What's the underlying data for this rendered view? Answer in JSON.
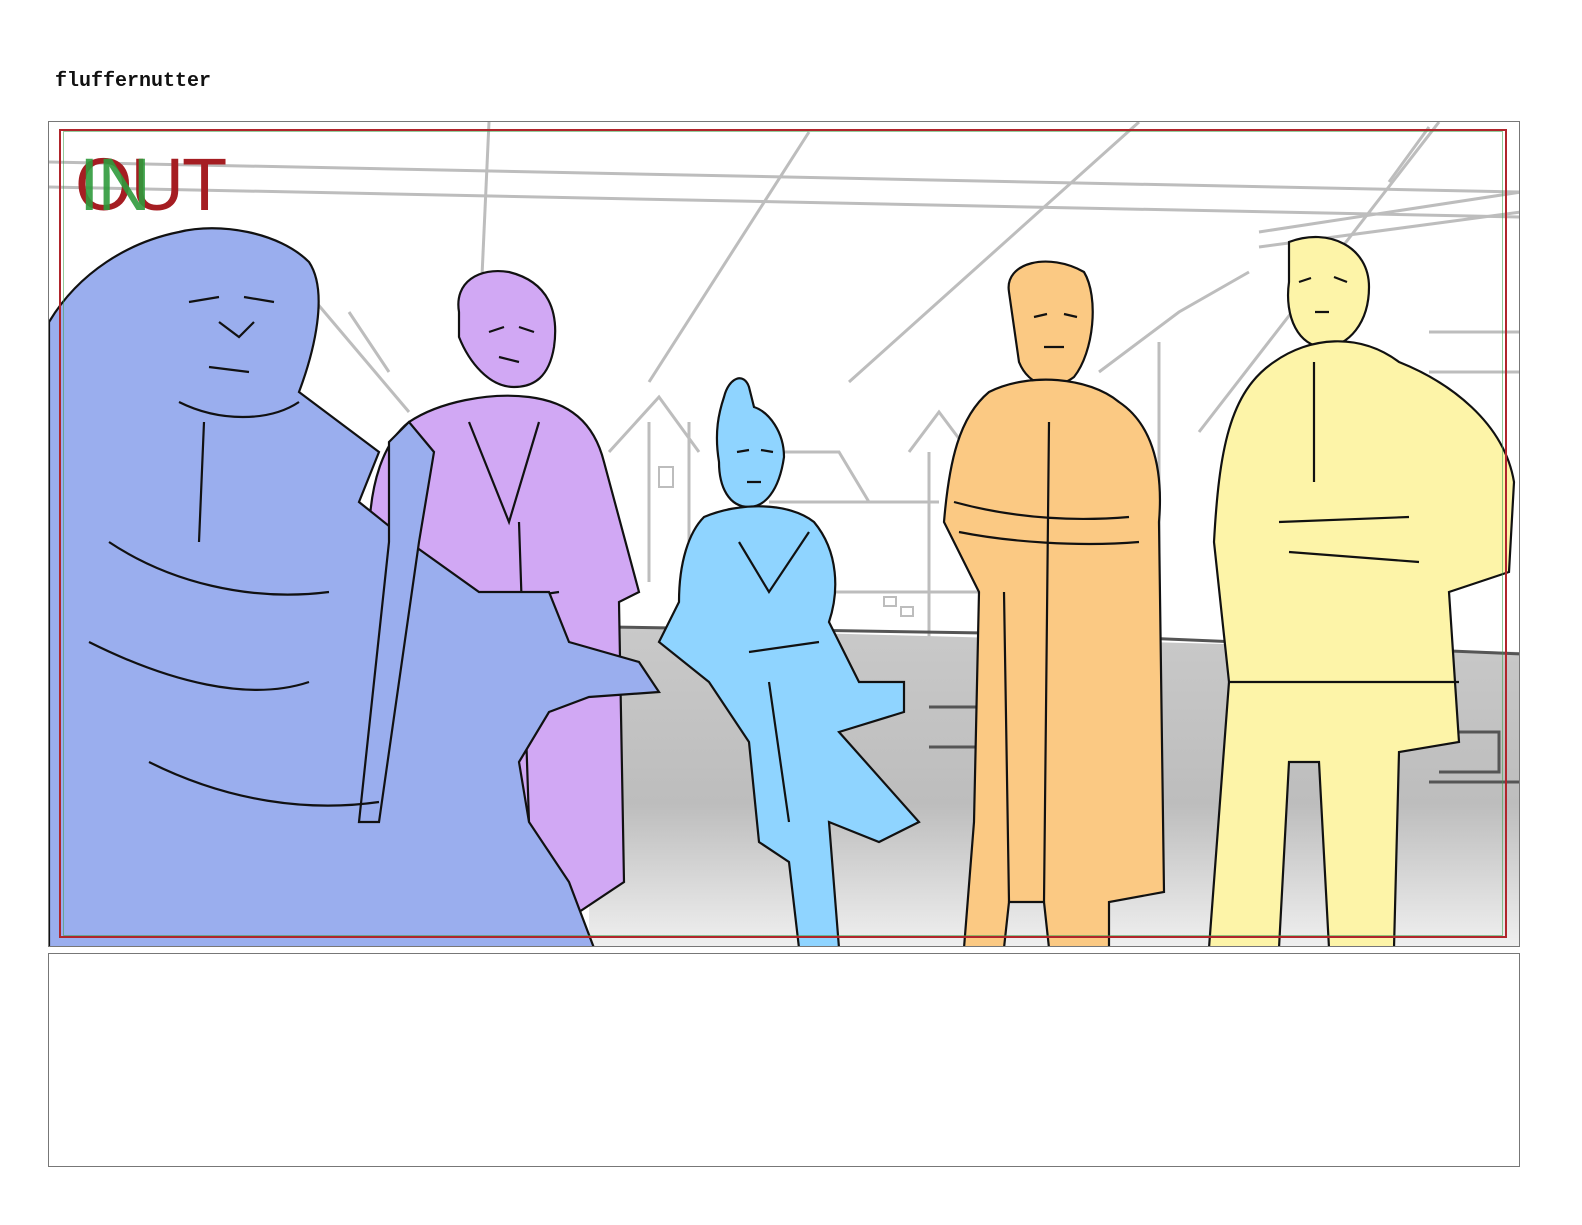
{
  "header": {
    "title": "fluffernutter"
  },
  "panel": {
    "marker_out": "OUT",
    "marker_in": "IN",
    "colors": {
      "safe_area": "#b0252b",
      "marker_out": "#a51d22",
      "marker_in": "#2f9b3c",
      "figure_1": "#9aaeee",
      "figure_2": "#d1a8f4",
      "figure_3": "#8fd4ff",
      "figure_4": "#fbc983",
      "figure_5": "#fdf4a8",
      "ground": "#c4c4c4"
    }
  },
  "notes": {
    "text": ""
  }
}
